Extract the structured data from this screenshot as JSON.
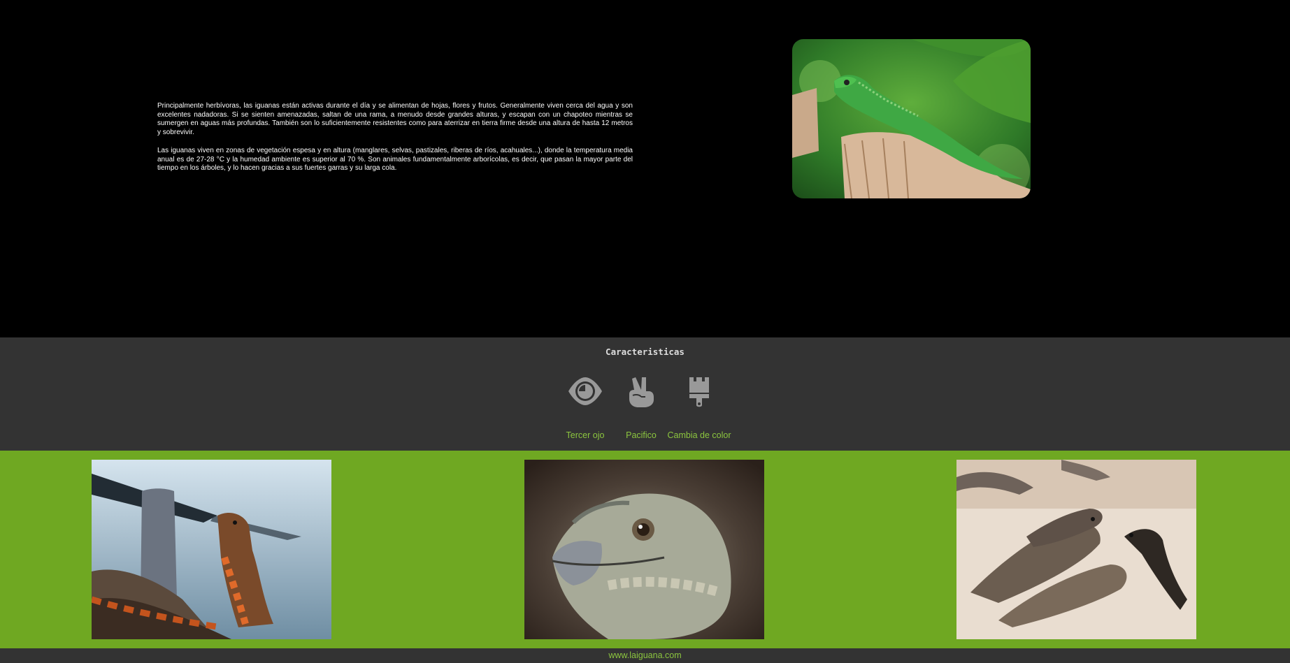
{
  "hero": {
    "paragraphs": [
      "Principalmente herbívoras, las iguanas están activas durante el día y se alimentan de hojas, flores y frutos. Generalmente viven cerca del agua y son excelentes nadadoras. Si se sienten amenazadas, saltan de una rama, a menudo desde grandes alturas, y escapan con un chapoteo mientras se sumergen en aguas más profundas. También son lo suficientemente resistentes como para aterrizar en tierra firme desde una altura de hasta 12 metros y sobrevivir.",
      "Las iguanas viven en zonas de vegetación espesa y en altura (manglares, selvas, pastizales, riberas de ríos, acahuales...), donde la temperatura media anual es de 27-28 °C y la humedad ambiente es superior al 70 %. Son animales fundamentalmente arborícolas, es decir, que pasan la mayor parte del tiempo en los árboles, y lo hacen gracias a sus fuertes garras y su larga cola."
    ],
    "photo_icon": "green-iguana-photo"
  },
  "features": {
    "title": "Caracteristicas",
    "items": [
      {
        "label": "Tercer ojo",
        "icon": "eye-icon"
      },
      {
        "label": "Pacifico",
        "icon": "peace-hand-icon"
      },
      {
        "label": "Cambia de color",
        "icon": "paintbrush-icon"
      }
    ]
  },
  "gallery": {
    "photos": [
      {
        "icon": "orange-iguana-photo"
      },
      {
        "icon": "iguana-head-photo"
      },
      {
        "icon": "iguanas-on-sand-photo"
      }
    ]
  },
  "footer": {
    "site": "www.laiguana.com"
  },
  "colors": {
    "page_background": "#000000",
    "features_background": "#333333",
    "gallery_background": "#6fa822",
    "accent_text": "#8cc63f",
    "icon_gray": "#999999"
  }
}
